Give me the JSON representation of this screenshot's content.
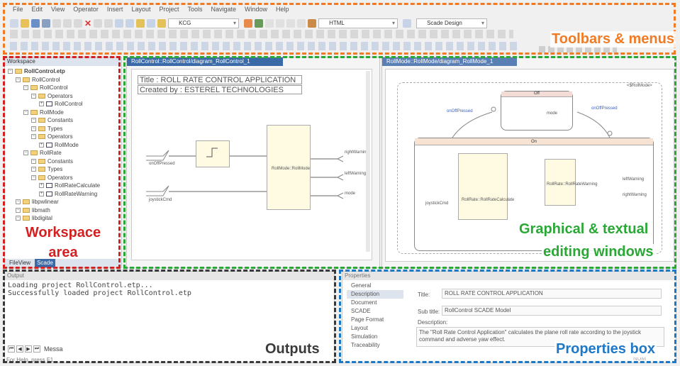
{
  "menu": [
    "File",
    "Edit",
    "View",
    "Operator",
    "Insert",
    "Layout",
    "Project",
    "Tools",
    "Navigate",
    "Window",
    "Help"
  ],
  "toolbar": {
    "combo_kcg": "KCG",
    "combo_html": "HTML",
    "combo_design": "Scade Design"
  },
  "workspace": {
    "title": "Workspace",
    "tree": [
      {
        "label": "RollControl.etp",
        "level": 0,
        "kind": "project"
      },
      {
        "label": "RollControl",
        "level": 1,
        "kind": "folder"
      },
      {
        "label": "RollControl",
        "level": 2,
        "kind": "folder"
      },
      {
        "label": "Operators",
        "level": 3,
        "kind": "folder"
      },
      {
        "label": "RollControl",
        "level": 4,
        "kind": "op"
      },
      {
        "label": "RollMode",
        "level": 2,
        "kind": "folder"
      },
      {
        "label": "Constants",
        "level": 3,
        "kind": "folder"
      },
      {
        "label": "Types",
        "level": 3,
        "kind": "folder"
      },
      {
        "label": "Operators",
        "level": 3,
        "kind": "folder"
      },
      {
        "label": "RollMode",
        "level": 4,
        "kind": "op"
      },
      {
        "label": "RollRate",
        "level": 2,
        "kind": "folder"
      },
      {
        "label": "Constants",
        "level": 3,
        "kind": "folder"
      },
      {
        "label": "Types",
        "level": 3,
        "kind": "folder"
      },
      {
        "label": "Operators",
        "level": 3,
        "kind": "folder"
      },
      {
        "label": "RollRateCalculate",
        "level": 4,
        "kind": "op"
      },
      {
        "label": "RollRateWarning",
        "level": 4,
        "kind": "op"
      },
      {
        "label": "libpwlinear",
        "level": 1,
        "kind": "folder"
      },
      {
        "label": "libmath",
        "level": 1,
        "kind": "folder"
      },
      {
        "label": "libdigital",
        "level": 1,
        "kind": "folder"
      }
    ],
    "bottom_tabs": [
      "FileView",
      "Scade"
    ]
  },
  "editor_left": {
    "tab": "RollControl::RollControl/diagram_RollControl_1",
    "title_line": "Title : ROLL RATE CONTROL APPLICATION",
    "created_line": "Created by : ESTEREL TECHNOLOGIES",
    "inputs": [
      "onOffPressed",
      "joystickCmd"
    ],
    "block": "RollMode::RollMode",
    "outputs": [
      "rightWarning",
      "leftWarning",
      "mode"
    ]
  },
  "editor_right": {
    "tab": "RollMode::RollMode/diagram_RollMode_1",
    "tag": "<$RollMode>",
    "state_off": "Off",
    "state_on": "On",
    "trans_left": "onOffPressed",
    "trans_right": "onOffPressed",
    "in_label": "joystickCmd",
    "block1": "RollRate::RollRateCalculate",
    "block2": "RollRate::RollRateWarning",
    "out1": "leftWarning",
    "out2": "rightWarning",
    "mode_lbl": "mode"
  },
  "output": {
    "title": "Output",
    "lines": [
      "Loading project RollControl.etp...",
      "Successfully loaded project RollControl.etp"
    ],
    "tab": "Messa",
    "status": "For Help, press F1"
  },
  "properties": {
    "title": "Properties",
    "list": [
      "General",
      "Description",
      "Document",
      "SCADE",
      "Page Format",
      "Layout",
      "Simulation",
      "Traceability"
    ],
    "title_label": "Title:",
    "title_value": "ROLL RATE CONTROL APPLICATION",
    "subtitle_label": "Sub title:",
    "subtitle_value": "RollControl SCADE Model",
    "desc_label": "Description:",
    "desc_value": "The \"Roll Rate Control Application\" calculates the plane roll rate according to the joystick command and adverse yaw effect.",
    "status_num": "NUM"
  },
  "annotations": {
    "toolbars": "Toolbars & menus",
    "workspace": "Workspace area",
    "editing1": "Graphical & textual",
    "editing2": "editing windows",
    "outputs": "Outputs",
    "properties": "Properties box"
  },
  "colors": {
    "orange": "#f07b24",
    "red": "#d42020",
    "green": "#2aa836",
    "dark": "#3a3a3a",
    "blue": "#1e78c8"
  }
}
